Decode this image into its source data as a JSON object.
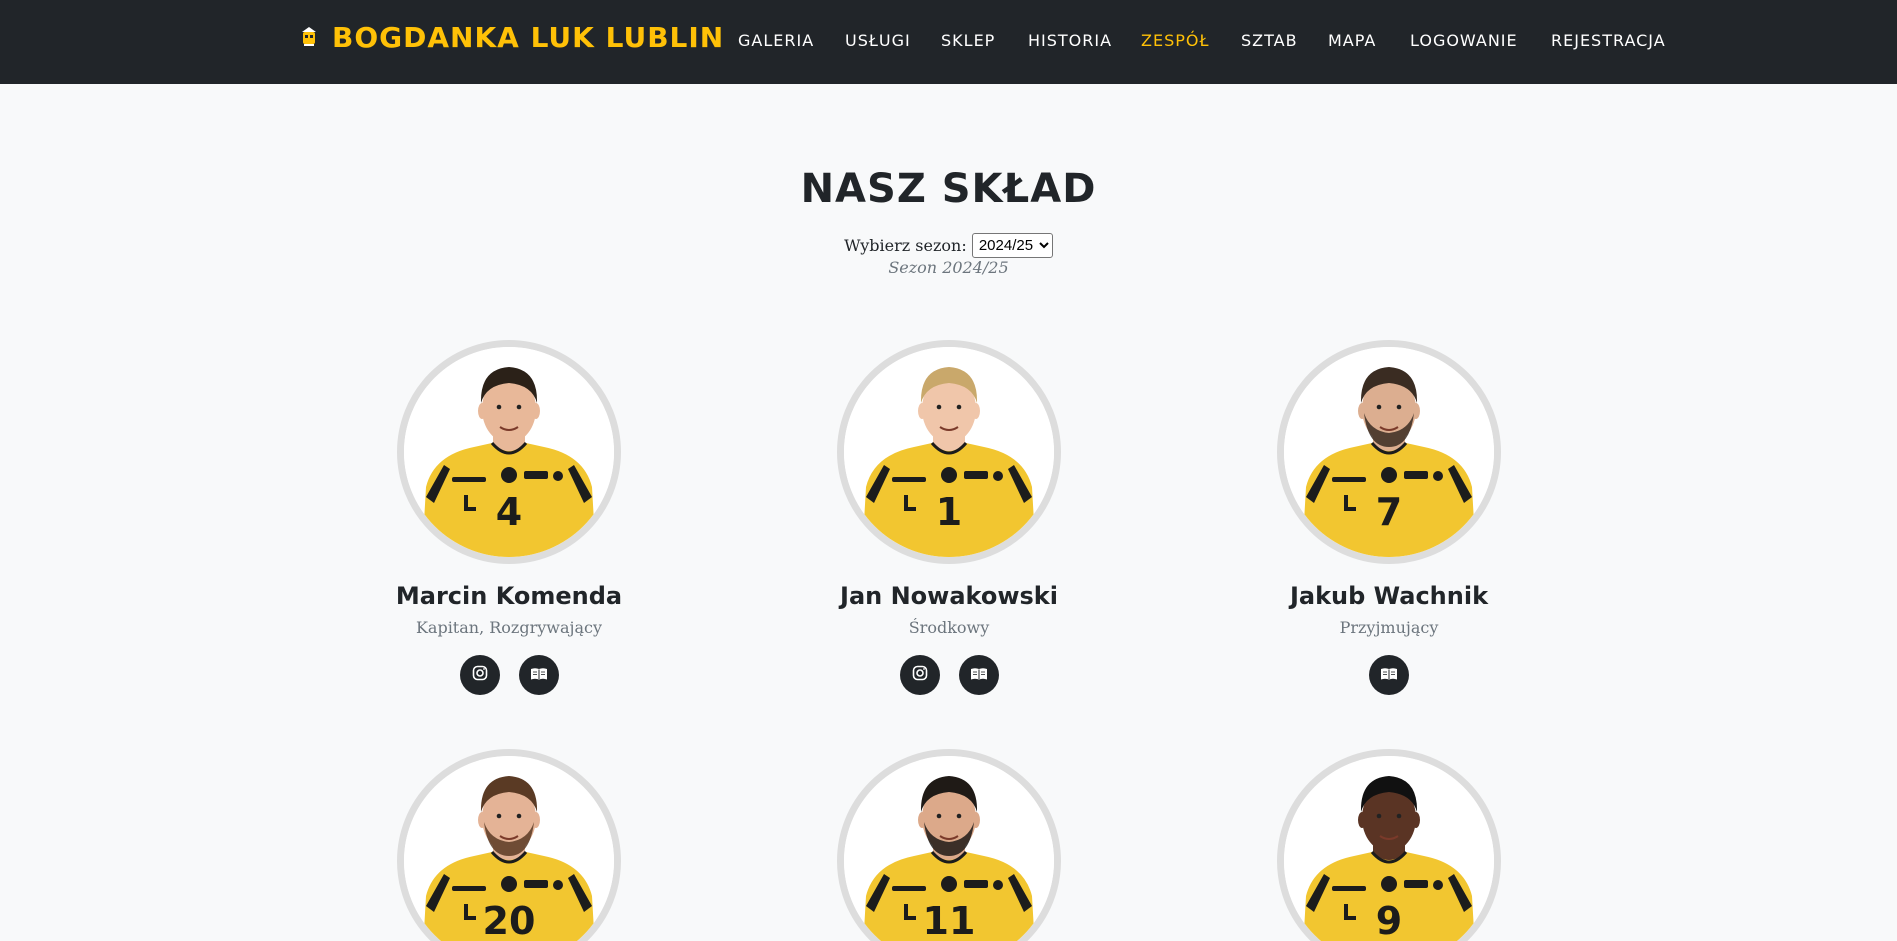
{
  "brand": {
    "name": "BOGDANKA LUK LUBLIN"
  },
  "nav": [
    {
      "label": "GALERIA",
      "active": false
    },
    {
      "label": "USŁUGI",
      "active": false
    },
    {
      "label": "SKLEP",
      "active": false
    },
    {
      "label": "HISTORIA",
      "active": false
    },
    {
      "label": "ZESPÓŁ",
      "active": true
    },
    {
      "label": "SZTAB",
      "active": false
    },
    {
      "label": "MAPA",
      "active": false
    },
    {
      "label": "LOGOWANIE",
      "active": false
    },
    {
      "label": "REJESTRACJA",
      "active": false
    }
  ],
  "page": {
    "title": "NASZ SKŁAD",
    "season_label": "Wybierz sezon:",
    "season_selected": "2024/25",
    "season_subtitle": "Sezon 2024/25"
  },
  "players": [
    {
      "name": "Marcin Komenda",
      "role": "Kapitan, Rozgrywający",
      "number": "4",
      "hair": "#2b2118",
      "skin": "#e8b899",
      "beard": false,
      "instagram": true,
      "bio": true
    },
    {
      "name": "Jan Nowakowski",
      "role": "Środkowy",
      "number": "1",
      "hair": "#c9a86b",
      "skin": "#f0c6aa",
      "beard": false,
      "instagram": true,
      "bio": true
    },
    {
      "name": "Jakub Wachnik",
      "role": "Przyjmujący",
      "number": "7",
      "hair": "#3a2c22",
      "skin": "#dcae90",
      "beard": true,
      "instagram": false,
      "bio": true
    },
    {
      "name": "",
      "role": "",
      "number": "20",
      "hair": "#5a3a24",
      "skin": "#e4b396",
      "beard": true,
      "instagram": false,
      "bio": false
    },
    {
      "name": "",
      "role": "",
      "number": "11",
      "hair": "#1f1a16",
      "skin": "#dca98a",
      "beard": true,
      "instagram": false,
      "bio": false
    },
    {
      "name": "",
      "role": "",
      "number": "9",
      "hair": "#111111",
      "skin": "#5a3424",
      "beard": false,
      "instagram": false,
      "bio": false
    }
  ],
  "colors": {
    "accent": "#ffc107",
    "navbar": "#212529",
    "jersey": "#f2c630"
  },
  "icons": {
    "instagram": "instagram-icon",
    "bio": "book-icon"
  }
}
